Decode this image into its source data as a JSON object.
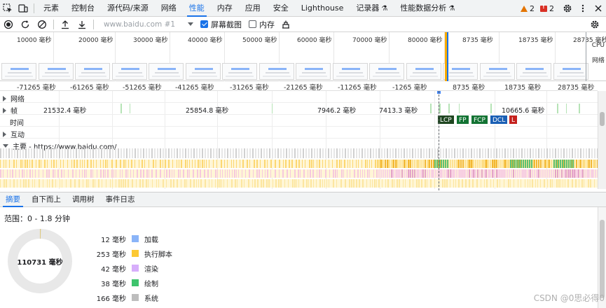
{
  "tabs": [
    {
      "label": "元素",
      "active": false,
      "experimental": false
    },
    {
      "label": "控制台",
      "active": false,
      "experimental": false
    },
    {
      "label": "源代码/来源",
      "active": false,
      "experimental": false
    },
    {
      "label": "网络",
      "active": false,
      "experimental": false
    },
    {
      "label": "性能",
      "active": true,
      "experimental": false
    },
    {
      "label": "内存",
      "active": false,
      "experimental": false
    },
    {
      "label": "应用",
      "active": false,
      "experimental": false
    },
    {
      "label": "安全",
      "active": false,
      "experimental": false
    },
    {
      "label": "Lighthouse",
      "active": false,
      "experimental": false
    },
    {
      "label": "记录器",
      "active": false,
      "experimental": true
    },
    {
      "label": "性能数据分析",
      "active": false,
      "experimental": true
    }
  ],
  "issues": {
    "warnings": "2",
    "errors": "2"
  },
  "toolbar": {
    "url_placeholder": "www.baidu.com #1",
    "screenshots_label": "屏幕截图",
    "screenshots_checked": true,
    "memory_label": "内存",
    "memory_checked": false
  },
  "overview": {
    "ticks": [
      "10000 毫秒",
      "20000 毫秒",
      "30000 毫秒",
      "40000 毫秒",
      "50000 毫秒",
      "60000 毫秒",
      "70000 毫秒",
      "80000 毫秒",
      "8735 毫秒",
      "18735 毫秒",
      "28735 毫秒"
    ],
    "cpu_label": "CPU",
    "net_label": "网络"
  },
  "ruler": {
    "ticks": [
      "-71265 毫秒",
      "-61265 毫秒",
      "-51265 毫秒",
      "-41265 毫秒",
      "-31265 毫秒",
      "-21265 毫秒",
      "-11265 毫秒",
      "-1265 毫秒",
      "8735 毫秒",
      "18735 毫秒",
      "28735 毫秒"
    ]
  },
  "tracks": {
    "network": "网络",
    "frames": "帧",
    "frame_values": [
      "21532.4 毫秒",
      "25854.8 毫秒",
      "7946.2 毫秒",
      "7413.3 毫秒",
      "10665.6 毫秒"
    ],
    "timings": "时间",
    "interactions": "互动",
    "main": "主要 - https://www.baidu.com/"
  },
  "markers": [
    {
      "label": "LCP",
      "color": "#1e4620"
    },
    {
      "label": "FP",
      "color": "#137333"
    },
    {
      "label": "FCP",
      "color": "#137333"
    },
    {
      "label": "DCL",
      "color": "#1a5fb4"
    },
    {
      "label": "L",
      "color": "#c5221f"
    }
  ],
  "bottom_tabs": [
    "摘要",
    "自下而上",
    "调用树",
    "事件日志"
  ],
  "summary": {
    "range": "范围：0 - 1.8 分钟",
    "total": "110731 毫秒",
    "items": [
      {
        "value": "12 毫秒",
        "label": "加载",
        "color": "#8ab4f8"
      },
      {
        "value": "253 毫秒",
        "label": "执行脚本",
        "color": "#fcc934"
      },
      {
        "value": "42 毫秒",
        "label": "渲染",
        "color": "#d7aefb"
      },
      {
        "value": "38 毫秒",
        "label": "绘制",
        "color": "#3ec46d"
      },
      {
        "value": "166 毫秒",
        "label": "系统",
        "color": "#bdbdbd"
      }
    ]
  },
  "watermark": "CSDN @0思必得0"
}
